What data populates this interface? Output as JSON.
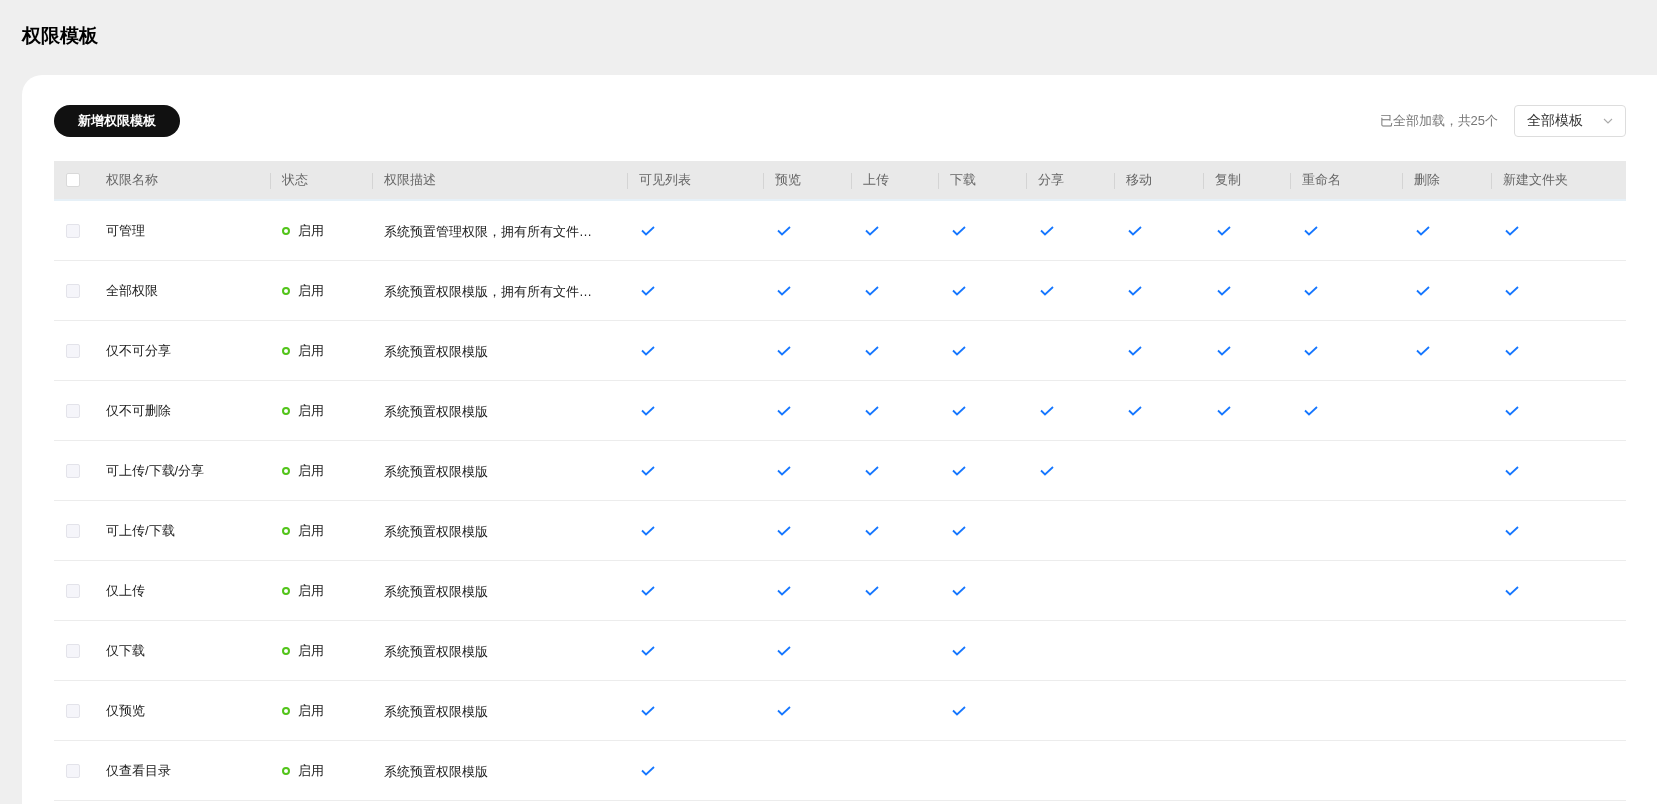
{
  "page_title": "权限模板",
  "add_button": "新增权限模板",
  "load_status": "已全部加载，共25个",
  "filter_select": {
    "value": "全部模板"
  },
  "table": {
    "select_all_checked": false,
    "columns": [
      "权限名称",
      "状态",
      "权限描述",
      "可见列表",
      "预览",
      "上传",
      "下载",
      "分享",
      "移动",
      "复制",
      "重命名",
      "删除",
      "新建文件夹"
    ],
    "rows": [
      {
        "checked": false,
        "name": "可管理",
        "status": "启用",
        "description": "系统预置管理权限，拥有所有文件…",
        "permissions": [
          true,
          true,
          true,
          true,
          true,
          true,
          true,
          true,
          true,
          true
        ]
      },
      {
        "checked": false,
        "name": "全部权限",
        "status": "启用",
        "description": "系统预置权限模版，拥有所有文件…",
        "permissions": [
          true,
          true,
          true,
          true,
          true,
          true,
          true,
          true,
          true,
          true
        ]
      },
      {
        "checked": false,
        "name": "仅不可分享",
        "status": "启用",
        "description": "系统预置权限模版",
        "permissions": [
          true,
          true,
          true,
          true,
          false,
          true,
          true,
          true,
          true,
          true
        ]
      },
      {
        "checked": false,
        "name": "仅不可删除",
        "status": "启用",
        "description": "系统预置权限模版",
        "permissions": [
          true,
          true,
          true,
          true,
          true,
          true,
          true,
          true,
          false,
          true
        ]
      },
      {
        "checked": false,
        "name": "可上传/下载/分享",
        "status": "启用",
        "description": "系统预置权限模版",
        "permissions": [
          true,
          true,
          true,
          true,
          true,
          false,
          false,
          false,
          false,
          true
        ]
      },
      {
        "checked": false,
        "name": "可上传/下载",
        "status": "启用",
        "description": "系统预置权限模版",
        "permissions": [
          true,
          true,
          true,
          true,
          false,
          false,
          false,
          false,
          false,
          true
        ]
      },
      {
        "checked": false,
        "name": "仅上传",
        "status": "启用",
        "description": "系统预置权限模版",
        "permissions": [
          true,
          true,
          true,
          true,
          false,
          false,
          false,
          false,
          false,
          true
        ]
      },
      {
        "checked": false,
        "name": "仅下载",
        "status": "启用",
        "description": "系统预置权限模版",
        "permissions": [
          true,
          true,
          false,
          true,
          false,
          false,
          false,
          false,
          false,
          false
        ]
      },
      {
        "checked": false,
        "name": "仅预览",
        "status": "启用",
        "description": "系统预置权限模版",
        "permissions": [
          true,
          true,
          false,
          true,
          false,
          false,
          false,
          false,
          false,
          false
        ]
      },
      {
        "checked": false,
        "name": "仅查看目录",
        "status": "启用",
        "description": "系统预置权限模版",
        "permissions": [
          true,
          false,
          false,
          false,
          false,
          false,
          false,
          false,
          false,
          false
        ]
      }
    ]
  }
}
